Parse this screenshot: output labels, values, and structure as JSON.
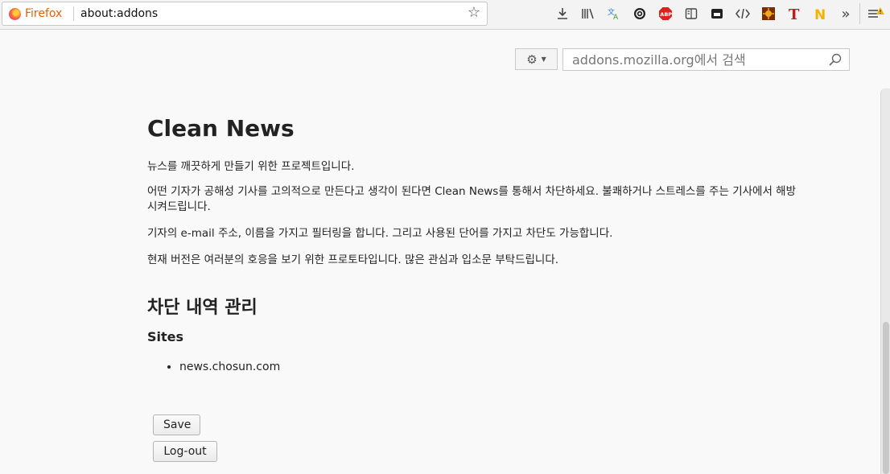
{
  "browser": {
    "identity_label": "Firefox",
    "url": "about:addons"
  },
  "toolbar_icons": [
    "download-icon",
    "library-icon",
    "translate-icon",
    "pocket-icon",
    "adblock-plus-icon",
    "reader-view-icon",
    "screenshot-icon",
    "devtools-icon",
    "extension-sun-icon",
    "extension-t-icon",
    "extension-n-icon",
    "overflow-icon",
    "menu-icon"
  ],
  "colors": {
    "firefox_accent": "#e66000",
    "abp_red": "#d9231c"
  },
  "addons_header": {
    "search_placeholder": "addons.mozilla.org에서 검색"
  },
  "addon": {
    "title": "Clean News",
    "paragraphs": [
      "뉴스를 깨끗하게 만들기 위한 프로젝트입니다.",
      "어떤 기자가 공해성 기사를 고의적으로 만든다고 생각이 된다면 Clean News를 통해서 차단하세요. 불쾌하거나 스트레스를 주는 기사에서 해방시켜드립니다.",
      "기자의 e-mail 주소, 이름을 가지고 필터링을 합니다. 그리고 사용된 단어를 가지고 차단도 가능합니다.",
      "현재 버전은 여러분의 호응을 보기 위한 프로토타입니다. 많은 관심과 입소문 부탁드립니다."
    ],
    "section_title": "차단 내역 관리",
    "sites_heading": "Sites",
    "sites": [
      "news.chosun.com"
    ],
    "save_label": "Save",
    "logout_label": "Log-out"
  }
}
